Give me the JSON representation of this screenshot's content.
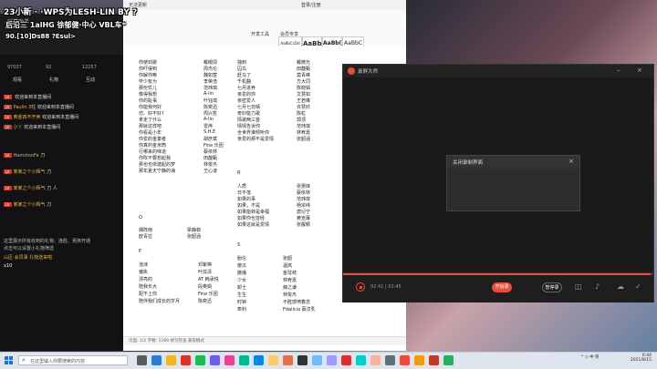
{
  "overlay": {
    "line1": "23小新 · ·WPS为LESH-LIN BY ?",
    "line2": "后沿三 1alHG 徐郁健·中心 VBL车*",
    "line3": "90.[10]Ds88 ?Esul>"
  },
  "doc": {
    "tab": "无法更新",
    "menus": [
      "开发工具",
      "会员专享"
    ],
    "login": "登录/注册",
    "styles": [
      "AaBbCcDd",
      "AaBb",
      "AaBb(",
      "AaBbC"
    ],
    "status": "页面: 1/2  字数: 1289  拼写检查  兼容模式"
  },
  "lyrics": {
    "col1": [
      "你使劲跳",
      "你吓得到",
      "你解你嘛",
      "毕少有为",
      "那份忧儿",
      "像得我想",
      "你的耻事",
      "你能我何好",
      "仿、好不好?",
      "拿走了什么",
      "那就这样吧",
      "你看是小年",
      "你爱的金童者",
      "你真的金米筒",
      "行哪来的味道",
      "你吹不要想起我",
      "那也也依建起的梦",
      "那年夏天宁静的海"
    ],
    "col2": [
      "戴眼闺",
      "周杰伦",
      "魏如萱",
      "李荣浩",
      "范玮琪",
      "A-lin",
      "叶钰琪",
      "陈奕迅",
      "周兴哲",
      "A-lin",
      "雷烨",
      "S.H.E",
      "胡彦斌",
      "Fine 乐团",
      "蔡依林",
      "田馥甄",
      "林俊杰",
      "王心凌"
    ],
    "col3": [
      "独刺",
      "囚鸟",
      "赶马了",
      "千机翻",
      "七月进养",
      "亲爱的你",
      "亲密爱人",
      "七月七日晴",
      "奇妙能力歌",
      "情歌两三首",
      "情情告诉你",
      "全世界谁倾听你",
      "亲爱的那不是爱情"
    ],
    "col4": [
      "戴微光",
      "田馥甄",
      "莫青峰",
      "方大同",
      "陈晓娟",
      "文慧如",
      "王若琳",
      "许慧欣",
      "陈粒",
      "郭顶",
      "范玮琪",
      "林宥嘉",
      "张韶涵"
    ],
    "letter_r": "R",
    "col5": [
      "人质",
      "日不落",
      "如果的事",
      "如果，不是",
      "如果能转是幸福",
      "如果你也曾经",
      "如果这就是爱情"
    ],
    "col6": [
      "张惠妹",
      "蔡依林",
      "范玮琪",
      "杨宗纬",
      "唐衍宁",
      "黄宣蘸",
      "张靓颖"
    ],
    "letter_o": "O",
    "col7": [
      "偶阵雨",
      "欧青拉"
    ],
    "col8": [
      "梁静茹",
      "张韶涵"
    ],
    "letter_s": "S",
    "letter_p": "P",
    "col9": [
      "泡沫",
      "偏执",
      "漂亮的",
      "陪我长大",
      "配不上你",
      "陪伴我们成长的岁月"
    ],
    "col10": [
      "邓紫棋",
      "叶炫清",
      "AT 韩承悦",
      "段奥娟",
      "Fine 乐团",
      "陈奕迅"
    ],
    "col11": [
      "胎伦",
      "傻瓜",
      "撒播",
      "少女",
      "卸士",
      "生生",
      "时钟",
      "牵利"
    ],
    "col12": [
      "张韶",
      "温岚",
      "金玟岐",
      "林宥嘉",
      "薛之谦",
      "林俊杰",
      "不胜感喷着念",
      "Fdalicia 蔡淳乳"
    ]
  },
  "obs": {
    "title": "弹幕助手",
    "stats": [
      "97037",
      "92",
      "12257"
    ],
    "tabs": [
      "观看",
      "礼物",
      "互动"
    ],
    "messages": [
      {
        "tag": "LV",
        "name": "",
        "text": "欢迎来到本直播间"
      },
      {
        "tag": "LV",
        "name": "Paulin 3柱",
        "text": "欢迎来到本直播间"
      },
      {
        "tag": "LV",
        "name": "黄金四不开卖",
        "text": "欢迎来到本直播间"
      },
      {
        "tag": "LV",
        "name": "小丫",
        "text": "欢迎来到本直播间"
      },
      {
        "tag": "LV",
        "name": "HamstonFe",
        "text": "刀"
      },
      {
        "tag": "LV",
        "name": "某某之个小辉气",
        "text": "刀"
      },
      {
        "tag": "LV",
        "name": "某某之个小辉气",
        "text": "刀 人"
      },
      {
        "tag": "LV",
        "name": "某某之个小辉气",
        "text": "刀"
      }
    ],
    "footer1": "这里展示所有收到的礼物、连胜、贡族开通",
    "footer2": "点击可以设置小礼物筛选",
    "gift_user": "山区·会员事",
    "gift_text": "礼物送来啦",
    "count": "x10"
  },
  "recorder": {
    "title": "录屏大师",
    "dialog_title": "关闭录制界面",
    "time": "02:41 | 02:45",
    "btn_start": "开始录",
    "btn_pause": "暂停录",
    "progress": 0.99
  },
  "taskbar": {
    "search_placeholder": "在这里输入你要搜索的内容",
    "tray": "^ ◇ 中 英",
    "time": "6:44",
    "date": "2021/8/15"
  },
  "colors": {
    "accent": "#e74c3c",
    "start": "#1f6fd6"
  }
}
